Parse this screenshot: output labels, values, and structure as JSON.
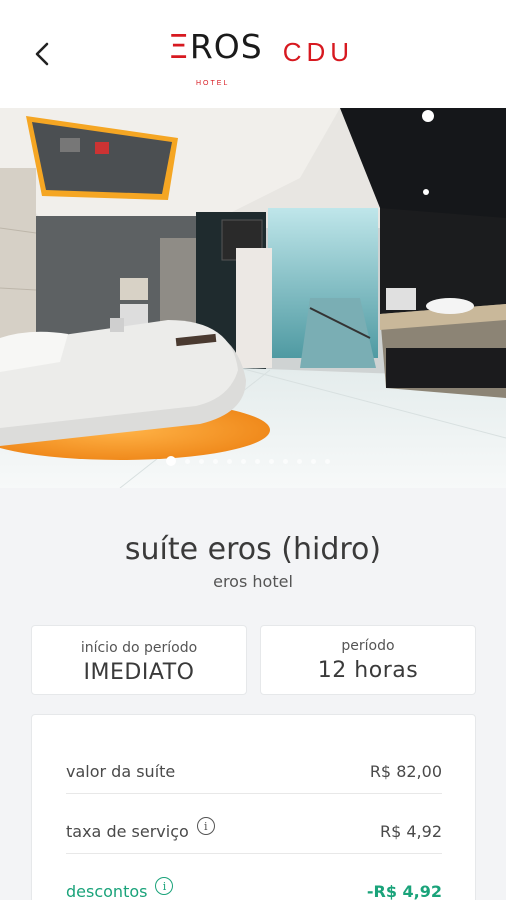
{
  "header": {
    "back_icon": "chevron-left-icon",
    "logo": {
      "name": "EROS",
      "sub": "HOTEL",
      "city": "CDU"
    },
    "brand_color": "#d71920"
  },
  "gallery": {
    "total_images": 12,
    "active_index": 0
  },
  "suite": {
    "name": "suíte eros (hidro)",
    "hotel": "eros hotel"
  },
  "period": {
    "start_label": "início do período",
    "start_value": "IMEDIATO",
    "duration_label": "período",
    "duration_value": "12 horas"
  },
  "pricing": {
    "rows": [
      {
        "label": "valor da suíte",
        "value": "R$ 82,00"
      },
      {
        "label": "taxa de serviço",
        "value": "R$ 4,92",
        "info_icon": "info-icon"
      },
      {
        "label": "descontos",
        "value": "-R$ 4,92",
        "info_icon": "info-icon"
      }
    ],
    "discount_color": "#1aa37a"
  }
}
